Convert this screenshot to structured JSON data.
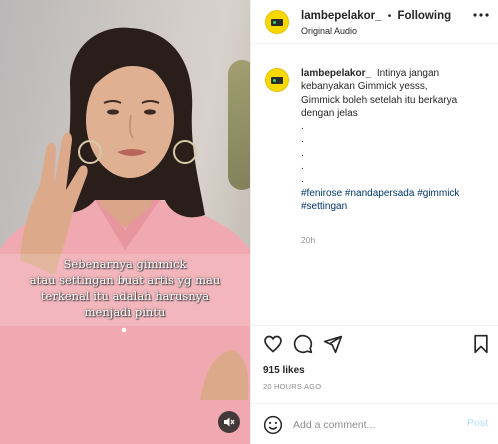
{
  "post": {
    "username": "lambepelakor_",
    "separator": "•",
    "follow_label": "Following",
    "audio_label": "Original Audio",
    "caption_lines": [
      "Intinya jangan",
      "kebanyakan Gimmick yesss,",
      "Gimmick boleh setelah itu berkarya",
      "dengan jelas",
      ".",
      ".",
      ".",
      ".",
      "."
    ],
    "hashtags_line1": "#fenirose #nandapersada #gimmick",
    "hashtags_line2": "#settingan",
    "time": "20h",
    "likes": "915 likes",
    "posted_ago": "20 HOURS AGO"
  },
  "video": {
    "subtitle_lines": [
      "Sebenarnya gimmick",
      "atau settingan buat artis yg mau",
      "terkenal itu adalah harusnya",
      "menjadi pintu"
    ]
  },
  "comment_box": {
    "placeholder": "Add a comment...",
    "post_label": "Post"
  },
  "icons": {
    "more": "more-horizontal-icon",
    "like": "heart-icon",
    "comment": "comment-bubble-icon",
    "share": "paper-plane-icon",
    "save": "bookmark-icon",
    "emoji": "smiley-icon",
    "mute": "speaker-muted-icon"
  },
  "colors": {
    "accent_link": "#00376b",
    "muted_text": "#8e8e8e",
    "post_button": "#b2dffc",
    "avatar_yellow": "#f7d900",
    "shirt_pink": "#f2a7b0"
  }
}
